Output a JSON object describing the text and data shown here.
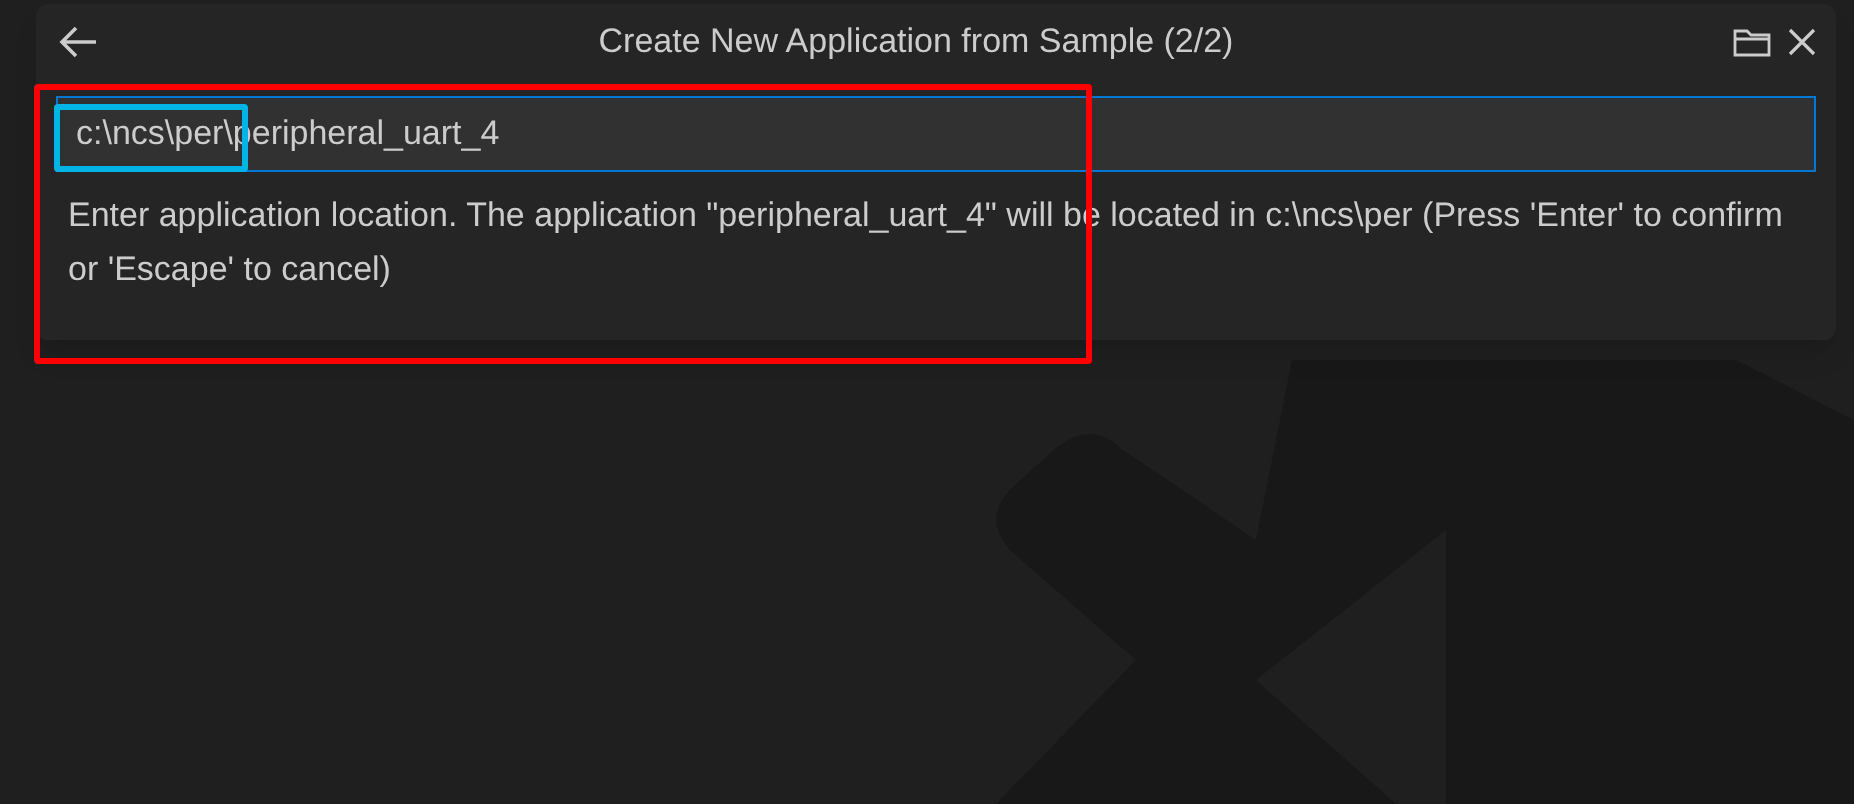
{
  "dialog": {
    "title": "Create New Application from Sample (2/2)",
    "input": {
      "value": "c:\\ncs\\per\\peripheral_uart_4"
    },
    "message": "Enter application location. The application \"peripheral_uart_4\" will be located in c:\\ncs\\per (Press 'Enter' to confirm or 'Escape' to cancel)"
  },
  "annotations": [
    {
      "kind": "rectangle",
      "color": "#ff0000"
    },
    {
      "kind": "highlight",
      "color": "#00b4e6"
    }
  ]
}
